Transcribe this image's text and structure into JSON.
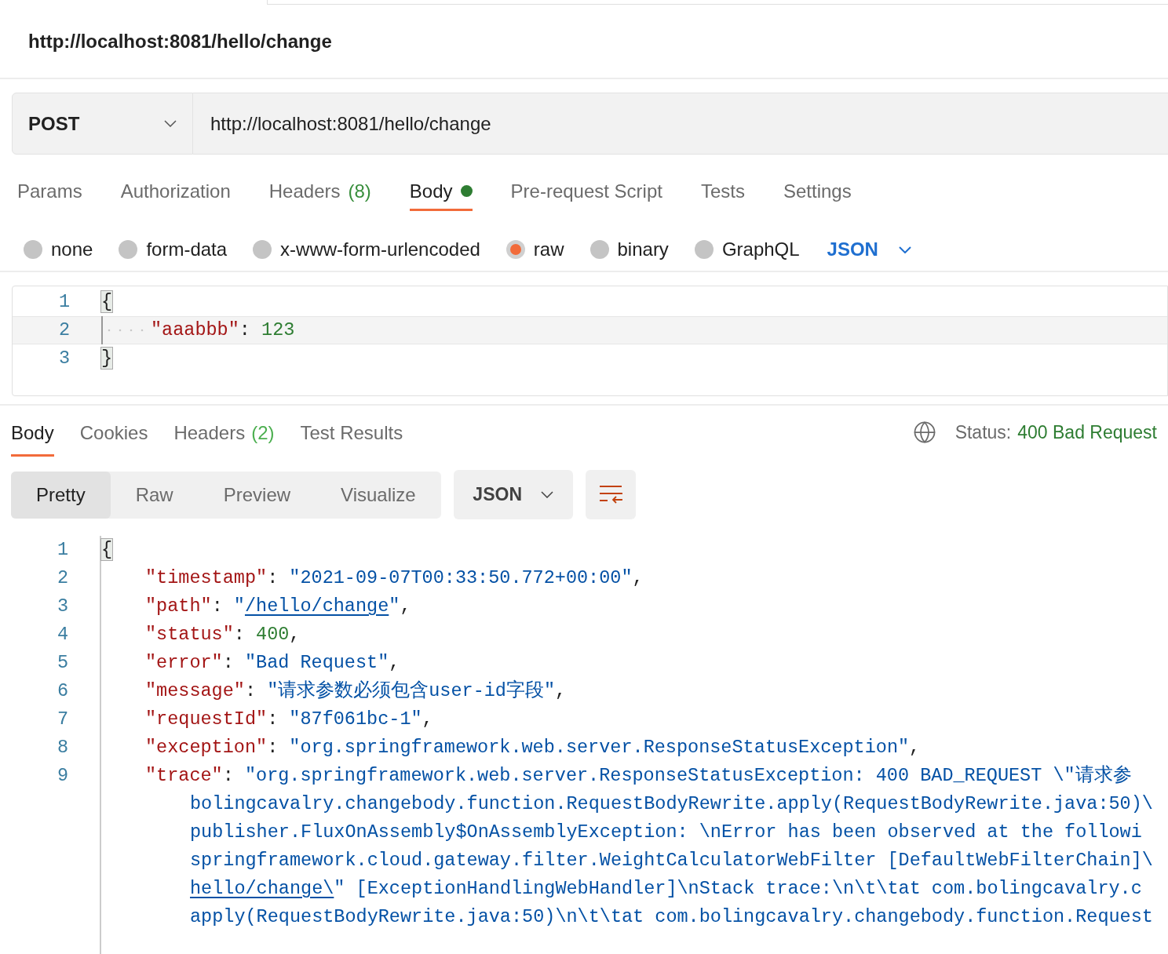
{
  "request": {
    "title": "http://localhost:8081/hello/change",
    "method": "POST",
    "url": "http://localhost:8081/hello/change"
  },
  "request_tabs": [
    {
      "label": "Params",
      "selected": false
    },
    {
      "label": "Authorization",
      "selected": false
    },
    {
      "label": "Headers",
      "count": "(8)",
      "selected": false
    },
    {
      "label": "Body",
      "selected": true,
      "dot": true
    },
    {
      "label": "Pre-request Script",
      "selected": false
    },
    {
      "label": "Tests",
      "selected": false
    },
    {
      "label": "Settings",
      "selected": false
    }
  ],
  "body_types": [
    {
      "label": "none",
      "selected": false
    },
    {
      "label": "form-data",
      "selected": false
    },
    {
      "label": "x-www-form-urlencoded",
      "selected": false
    },
    {
      "label": "raw",
      "selected": true
    },
    {
      "label": "binary",
      "selected": false
    },
    {
      "label": "GraphQL",
      "selected": false
    }
  ],
  "body_format": "JSON",
  "request_body": [
    {
      "number": "1",
      "segments": [
        {
          "kind": "brace",
          "text": "{"
        }
      ]
    },
    {
      "number": "2",
      "indent": true,
      "segments": [
        {
          "kind": "key",
          "text": "\"aaabbb\""
        },
        {
          "kind": "punct",
          "text": ": "
        },
        {
          "kind": "number",
          "text": "123"
        }
      ]
    },
    {
      "number": "3",
      "segments": [
        {
          "kind": "brace",
          "text": "}"
        }
      ]
    }
  ],
  "response_tabs": [
    {
      "label": "Body",
      "selected": true
    },
    {
      "label": "Cookies",
      "selected": false
    },
    {
      "label": "Headers",
      "count": "(2)",
      "selected": false
    },
    {
      "label": "Test Results",
      "selected": false
    }
  ],
  "status": {
    "label": "Status:",
    "value": "400 Bad Request"
  },
  "view_modes": [
    {
      "label": "Pretty",
      "selected": true
    },
    {
      "label": "Raw",
      "selected": false
    },
    {
      "label": "Preview",
      "selected": false
    },
    {
      "label": "Visualize",
      "selected": false
    }
  ],
  "response_format": "JSON",
  "response_body": [
    {
      "number": "1",
      "segments": [
        {
          "kind": "brace",
          "text": "{"
        }
      ]
    },
    {
      "number": "2",
      "segments": [
        {
          "kind": "key",
          "text": "\"timestamp\""
        },
        {
          "kind": "punct",
          "text": ": "
        },
        {
          "kind": "string",
          "text": "\"2021-09-07T00:33:50.772+00:00\""
        },
        {
          "kind": "punct",
          "text": ","
        }
      ]
    },
    {
      "number": "3",
      "segments": [
        {
          "kind": "key",
          "text": "\"path\""
        },
        {
          "kind": "punct",
          "text": ": "
        },
        {
          "kind": "string",
          "text": "\""
        },
        {
          "kind": "link",
          "text": "/hello/change"
        },
        {
          "kind": "string",
          "text": "\""
        },
        {
          "kind": "punct",
          "text": ","
        }
      ]
    },
    {
      "number": "4",
      "segments": [
        {
          "kind": "key",
          "text": "\"status\""
        },
        {
          "kind": "punct",
          "text": ": "
        },
        {
          "kind": "number",
          "text": "400"
        },
        {
          "kind": "punct",
          "text": ","
        }
      ]
    },
    {
      "number": "5",
      "segments": [
        {
          "kind": "key",
          "text": "\"error\""
        },
        {
          "kind": "punct",
          "text": ": "
        },
        {
          "kind": "string",
          "text": "\"Bad Request\""
        },
        {
          "kind": "punct",
          "text": ","
        }
      ]
    },
    {
      "number": "6",
      "segments": [
        {
          "kind": "key",
          "text": "\"message\""
        },
        {
          "kind": "punct",
          "text": ": "
        },
        {
          "kind": "string",
          "text": "\"请求参数必须包含user-id字段\""
        },
        {
          "kind": "punct",
          "text": ","
        }
      ]
    },
    {
      "number": "7",
      "segments": [
        {
          "kind": "key",
          "text": "\"requestId\""
        },
        {
          "kind": "punct",
          "text": ": "
        },
        {
          "kind": "string",
          "text": "\"87f061bc-1\""
        },
        {
          "kind": "punct",
          "text": ","
        }
      ]
    },
    {
      "number": "8",
      "segments": [
        {
          "kind": "key",
          "text": "\"exception\""
        },
        {
          "kind": "punct",
          "text": ": "
        },
        {
          "kind": "string",
          "text": "\"org.springframework.web.server.ResponseStatusException\""
        },
        {
          "kind": "punct",
          "text": ","
        }
      ]
    },
    {
      "number": "9",
      "segments": [
        {
          "kind": "key",
          "text": "\"trace\""
        },
        {
          "kind": "punct",
          "text": ": "
        },
        {
          "kind": "string",
          "text": "\"org.springframework.web.server.ResponseStatusException: 400 BAD_REQUEST \\\"请求参"
        }
      ],
      "continuation": [
        [
          {
            "kind": "string",
            "text": "bolingcavalry.changebody.function.RequestBodyRewrite.apply(RequestBodyRewrite.java:50)\\"
          }
        ],
        [
          {
            "kind": "string",
            "text": "publisher.FluxOnAssembly$OnAssemblyException: \\nError has been observed at the followi"
          }
        ],
        [
          {
            "kind": "string",
            "text": "springframework.cloud.gateway.filter.WeightCalculatorWebFilter [DefaultWebFilterChain]\\"
          }
        ],
        [
          {
            "kind": "link",
            "text": "hello/change\\"
          },
          {
            "kind": "string",
            "text": "\" [ExceptionHandlingWebHandler]\\nStack trace:\\n\\t\\tat com.bolingcavalry.c"
          }
        ],
        [
          {
            "kind": "string",
            "text": "apply(RequestBodyRewrite.java:50)\\n\\t\\tat com.bolingcavalry.changebody.function.Request"
          }
        ]
      ]
    }
  ]
}
